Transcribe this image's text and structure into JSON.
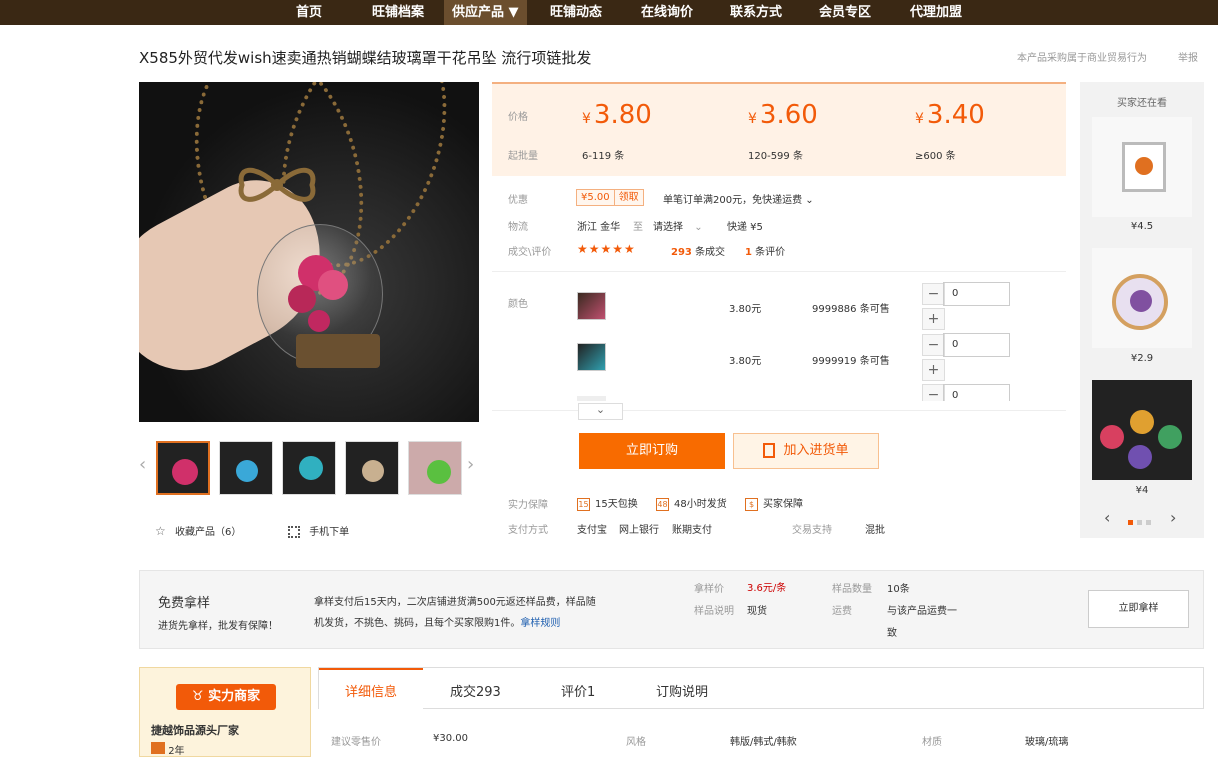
{
  "nav": {
    "items": [
      "首页",
      "旺铺档案",
      "供应产品 ▼",
      "旺铺动态",
      "在线询价",
      "联系方式",
      "会员专区",
      "代理加盟"
    ]
  },
  "product": {
    "title": "X585外贸代发wish速卖通热销蝴蝶结玻璃罩干花吊坠 流行项链批发"
  },
  "toplinks": {
    "trade": "本产品采购属于商业贸易行为",
    "report": "举报"
  },
  "pricing": {
    "price_label": "价格",
    "qty_label": "起批量",
    "tiers": [
      {
        "currency": "¥",
        "price": "3.80",
        "range": "6-119",
        "unit": "条"
      },
      {
        "currency": "¥",
        "price": "3.60",
        "range": "120-599",
        "unit": "条"
      },
      {
        "currency": "¥",
        "price": "3.40",
        "range": "≥600",
        "unit": "条"
      }
    ]
  },
  "promo": {
    "label": "优惠",
    "coupon_amount": "¥5.00",
    "coupon_action": "领取",
    "note": "单笔订单满200元，免快递运费"
  },
  "logistics": {
    "label": "物流",
    "from": "浙江 金华",
    "to_word": "至",
    "select": "请选择",
    "method": "快递 ¥5"
  },
  "deals": {
    "label": "成交\\评价",
    "stars": "★★★★★",
    "count": "293",
    "count_suffix": "条成交",
    "reviews": "1",
    "reviews_suffix": "条评价"
  },
  "sku": {
    "label": "颜色",
    "rows": [
      {
        "price": "3.80元",
        "stock": "9999886 条可售",
        "qty": "0"
      },
      {
        "price": "3.80元",
        "stock": "9999919 条可售",
        "qty": "0"
      },
      {
        "qty": "0"
      }
    ],
    "minus": "−",
    "plus": "+",
    "expand": "⌄"
  },
  "actions": {
    "buy": "立即订购",
    "cart": "加入进货单"
  },
  "guarantee": {
    "label": "实力保障",
    "items": [
      {
        "icon": "15",
        "text": "15天包换"
      },
      {
        "icon": "48",
        "text": "48小时发货"
      },
      {
        "icon": "$",
        "text": "买家保障"
      }
    ],
    "pay_label": "支付方式",
    "pay_methods": [
      "支付宝",
      "网上银行",
      "账期支付"
    ],
    "trade_support_label": "交易支持",
    "trade_support": "混批"
  },
  "gallery": {
    "fav": "收藏产品（6）",
    "mobile": "手机下单"
  },
  "sidebar": {
    "title": "买家还在看",
    "items": [
      {
        "price": "¥4.5"
      },
      {
        "price": "¥2.9"
      },
      {
        "price": "¥4"
      }
    ]
  },
  "sample": {
    "title": "免费拿样",
    "subtitle": "进货先拿样，批发有保障！",
    "desc_1": "拿样支付后15天内，二次店铺进货满500元返还样品费，样品随",
    "desc_2": "机发货，不挑色、挑码，且每个买家限购1件。",
    "rule_link": "拿样规则",
    "price_label": "拿样价",
    "price": "3.6元/条",
    "note_label": "样品说明",
    "note": "现货",
    "count_label": "样品数量",
    "count": "10条",
    "ship_label": "运费",
    "ship_1": "与该产品运费一",
    "ship_2": "致",
    "button": "立即拿样"
  },
  "merchant": {
    "badge": "实力商家",
    "name": "捷越饰品源头厂家",
    "years": "2年"
  },
  "tabs": [
    {
      "label": "详细信息"
    },
    {
      "label": "成交293"
    },
    {
      "label": "评价1"
    },
    {
      "label": "订购说明"
    }
  ],
  "details": [
    {
      "label": "建议零售价",
      "value": "¥30.00"
    },
    {
      "label": "风格",
      "value": "韩版/韩式/韩款"
    },
    {
      "label": "材质",
      "value": "玻璃/琉璃"
    }
  ],
  "colors": {
    "accent": "#f25a09",
    "nav_bg": "#3a2814",
    "buy_button": "#f86b00"
  }
}
